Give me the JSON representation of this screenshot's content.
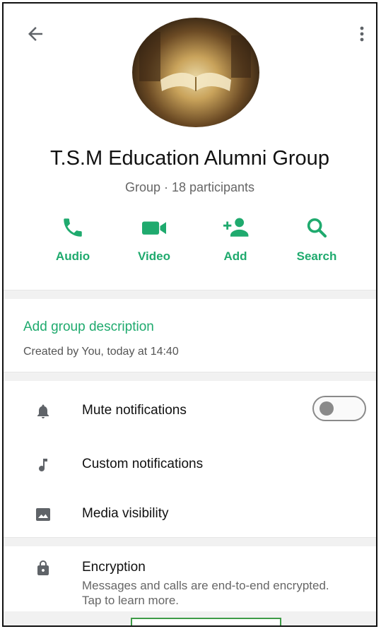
{
  "header": {
    "back_icon": "arrow-left-icon",
    "menu_icon": "more-vert-icon"
  },
  "group": {
    "title": "T.S.M Education Alumni Group",
    "subtitle": "Group · 18 participants"
  },
  "actions": [
    {
      "label": "Audio",
      "icon": "phone-icon"
    },
    {
      "label": "Video",
      "icon": "video-icon"
    },
    {
      "label": "Add",
      "icon": "add-person-icon"
    },
    {
      "label": "Search",
      "icon": "search-icon"
    }
  ],
  "description": {
    "link": "Add group description",
    "created": "Created by You, today at 14:40"
  },
  "settings": {
    "mute": {
      "label": "Mute notifications",
      "enabled": false
    },
    "custom": {
      "label": "Custom notifications"
    },
    "media": {
      "label": "Media visibility"
    },
    "encryption": {
      "label": "Encryption",
      "description": "Messages and calls are end-to-end encrypted. Tap to learn more."
    }
  },
  "colors": {
    "accent": "#1faa6e",
    "icon_gray": "#5f6368"
  }
}
